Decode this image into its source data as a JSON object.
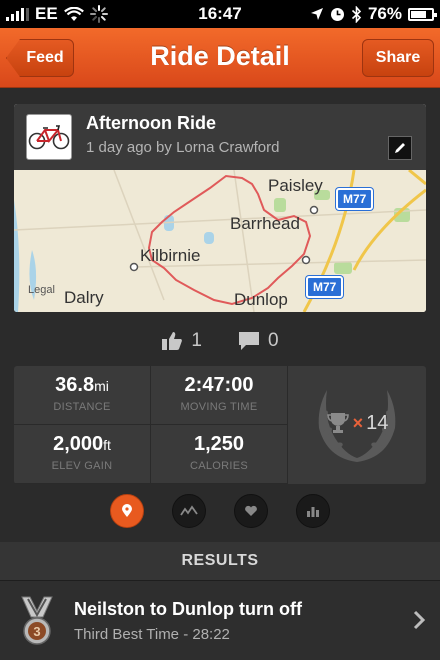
{
  "status_bar": {
    "carrier": "EE",
    "time": "16:47",
    "battery": "76%",
    "battery_level": 0.76
  },
  "nav": {
    "back_label": "Feed",
    "title": "Ride Detail",
    "share_label": "Share"
  },
  "activity": {
    "title": "Afternoon Ride",
    "subtitle": "1 day ago by Lorna Crawford"
  },
  "map": {
    "places": [
      "Paisley",
      "Barrhead",
      "Kilbirnie",
      "Dunlop",
      "Dalry"
    ],
    "road_shields": [
      "M77",
      "M77"
    ],
    "legal": "Legal",
    "route_color": "#e05a5a"
  },
  "social": {
    "kudos_count": "1",
    "comments_count": "0"
  },
  "stats": {
    "distance": {
      "value": "36.8",
      "unit": "mi",
      "label": "DISTANCE"
    },
    "moving_time": {
      "value": "2:47:00",
      "unit": "",
      "label": "MOVING TIME"
    },
    "elev_gain": {
      "value": "2,000",
      "unit": "ft",
      "label": "ELEV GAIN"
    },
    "calories": {
      "value": "1,250",
      "unit": "",
      "label": "CALORIES"
    },
    "achievements": "14",
    "achievements_prefix": "×"
  },
  "tabs": [
    {
      "icon": "map-pin-icon",
      "active": true
    },
    {
      "icon": "elevation-icon",
      "active": false
    },
    {
      "icon": "heart-icon",
      "active": false
    },
    {
      "icon": "bar-chart-icon",
      "active": false
    }
  ],
  "results": {
    "header": "RESULTS",
    "items": [
      {
        "medal": "3",
        "title": "Neilston to Dunlop turn off",
        "subtitle": "Third Best Time - 28:22"
      }
    ]
  },
  "colors": {
    "accent": "#e85a1f",
    "background": "#2b2b2b"
  }
}
